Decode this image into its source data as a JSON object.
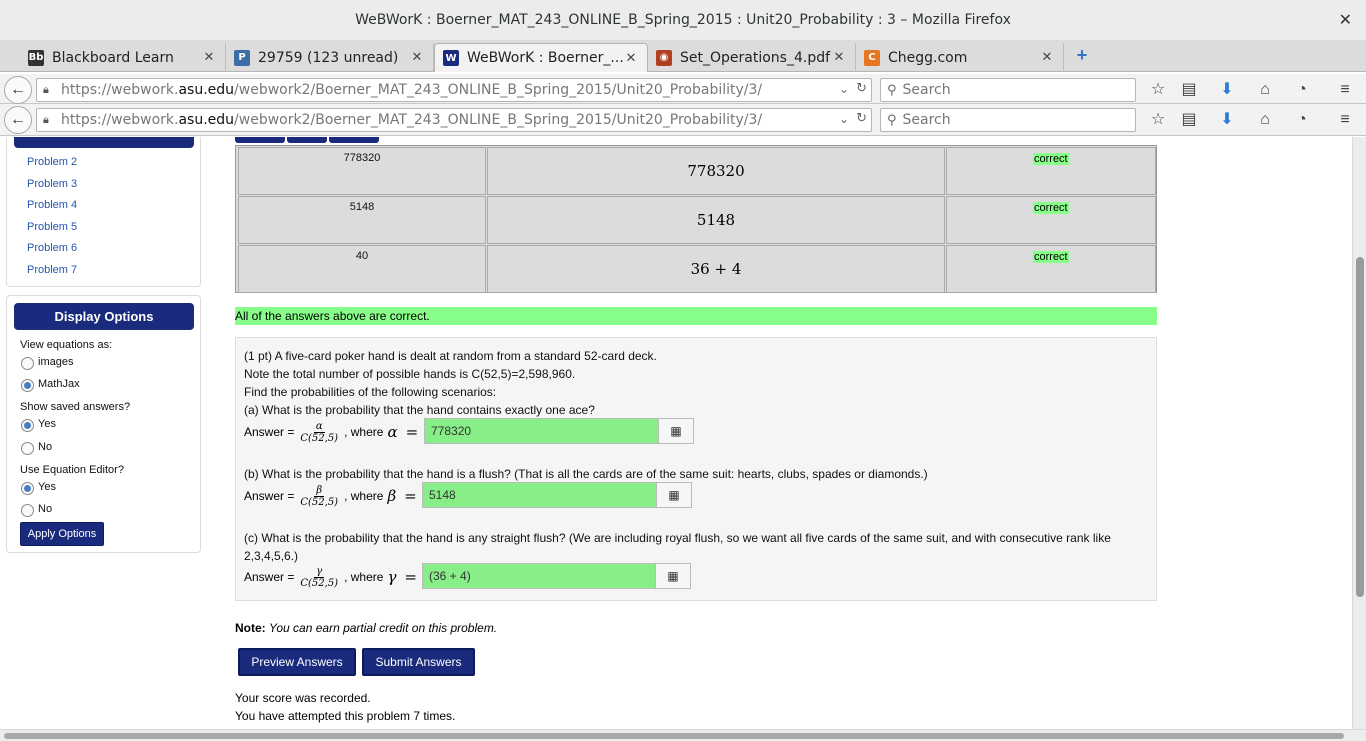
{
  "window": {
    "title": "WeBWorK : Boerner_MAT_243_ONLINE_B_Spring_2015 : Unit20_Probability : 3 – Mozilla Firefox",
    "close_glyph": "✕"
  },
  "tabs": [
    {
      "label": "Blackboard Learn",
      "favicon": "Bb",
      "favicon_color": "#333333"
    },
    {
      "label": "29759 (123 unread)",
      "favicon": "P",
      "favicon_color": "#3a6ea5"
    },
    {
      "label": "WeBWorK : Boerner_...",
      "favicon": "W",
      "favicon_color": "#1a2b7e"
    },
    {
      "label": "Set_Operations_4.pdf",
      "favicon": "◉",
      "favicon_color": "#b04020"
    },
    {
      "label": "Chegg.com",
      "favicon": "C",
      "favicon_color": "#e87722"
    }
  ],
  "tab_close_glyph": "✕",
  "new_tab_glyph": "+",
  "navbar": {
    "url_prefix": "https://webwork.",
    "url_host": "asu.edu",
    "url_path": "/webwork2/Boerner_MAT_243_ONLINE_B_Spring_2015/Unit20_Probability/3/",
    "search_placeholder": "Search"
  },
  "sidebar": {
    "problems": [
      "Problem 2",
      "Problem 3",
      "Problem 4",
      "Problem 5",
      "Problem 6",
      "Problem 7"
    ],
    "display_options": {
      "title": "Display Options",
      "view_equations_label": "View equations as:",
      "opt_images": "images",
      "opt_mathjax": "MathJax",
      "show_saved_label": "Show saved answers?",
      "yes": "Yes",
      "no": "No",
      "equation_editor_label": "Use Equation Editor?",
      "apply_label": "Apply Options"
    }
  },
  "results": [
    {
      "entered": "778320",
      "preview": "778320",
      "result": "correct"
    },
    {
      "entered": "5148",
      "preview": "5148",
      "result": "correct"
    },
    {
      "entered": "40",
      "preview": "36 + 4",
      "result": "correct"
    }
  ],
  "all_correct_message": "All of the answers above are correct.",
  "problem": {
    "line1": "(1 pt) A five-card poker hand is dealt at random from a standard 52-card deck.",
    "line2": "Note the total number of possible hands is C(52,5)=2,598,960.",
    "line3": "Find the probabilities of the following scenarios:",
    "part_a": "(a) What is the probability that the hand contains exactly one ace?",
    "part_b": "(b) What is the probability that the hand is a flush? (That is all the cards are of the same suit: hearts, clubs, spades or diamonds.)",
    "part_c_1": "(c) What is the probability that the hand is any straight flush? (We are including royal flush, so we want all five cards of the same suit, and with consecutive rank like",
    "part_c_2": "2,3,4,5,6.)",
    "answer_label": "Answer =",
    "where_label": ", where",
    "denominator": "C(52,5)",
    "alpha": "α",
    "beta": "β",
    "gamma": "γ",
    "equals": "=",
    "answer_a": "778320",
    "answer_b": "5148",
    "answer_c": "(36 + 4)"
  },
  "note_label": "Note:",
  "note_text": "You can earn partial credit on this problem.",
  "buttons": {
    "preview": "Preview Answers",
    "submit": "Submit Answers"
  },
  "status_recorded": "Your score was recorded.",
  "status_attempts": "You have attempted this problem 7 times."
}
